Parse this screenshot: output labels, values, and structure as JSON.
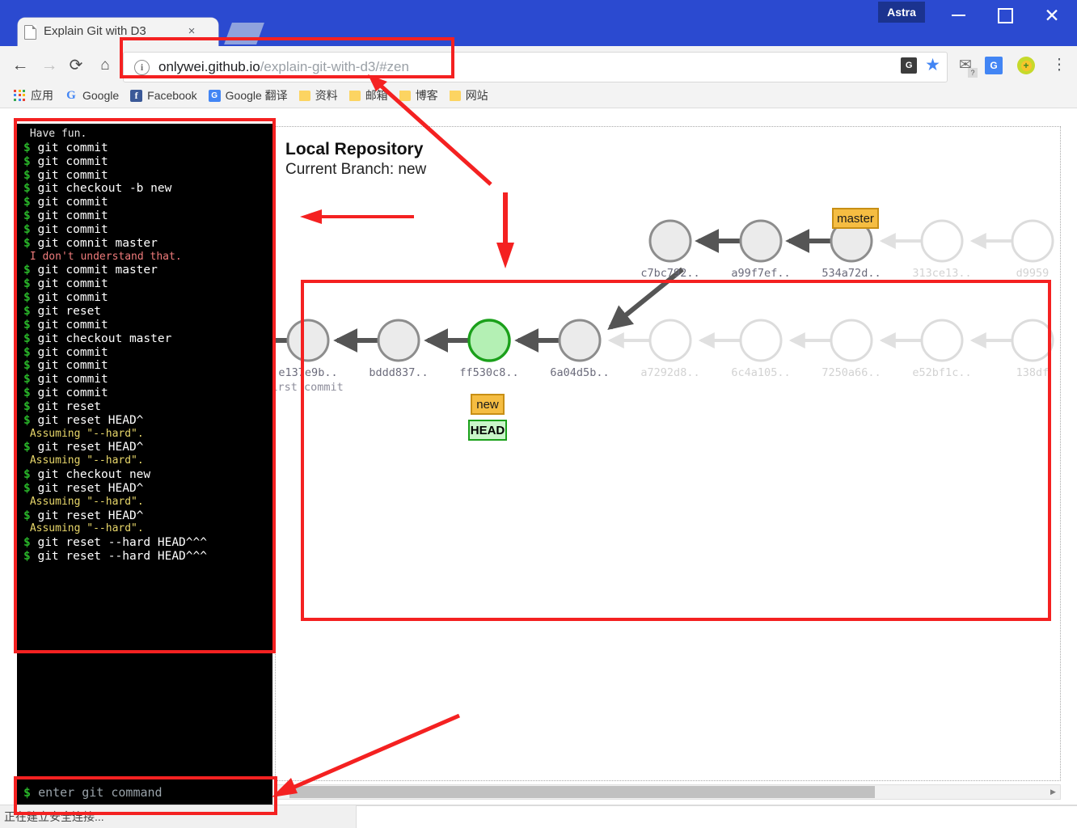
{
  "window": {
    "badge_label": "Astra",
    "minimize_icon": "minimize-icon",
    "maximize_icon": "maximize-icon",
    "close_icon": "close-icon"
  },
  "tab": {
    "title": "Explain Git with D3",
    "close_label": "×",
    "favicon": "page-icon"
  },
  "toolbar": {
    "back_glyph": "←",
    "forward_glyph": "→",
    "reload_glyph": "⟳",
    "home_glyph": "⌂",
    "url_host": "onlywei.github.io",
    "url_path": "/explain-git-with-d3/#zen",
    "url_full": "onlywei.github.io/explain-git-with-d3/#zen",
    "translate_badge": "G",
    "star_glyph": "★",
    "ext_mail_glyph": "M",
    "ext_mail_badge": "?",
    "ext_translate_badge": "G",
    "ext_green_badge": "+",
    "menu_glyph": "⋮"
  },
  "bookmarks": [
    {
      "label": "应用",
      "icon": "apps-grid-icon"
    },
    {
      "label": "Google",
      "icon": "google-icon"
    },
    {
      "label": "Facebook",
      "icon": "facebook-icon"
    },
    {
      "label": "Google 翻译",
      "icon": "google-translate-icon"
    },
    {
      "label": "资料",
      "icon": "folder-icon"
    },
    {
      "label": "邮箱",
      "icon": "folder-icon"
    },
    {
      "label": "博客",
      "icon": "folder-icon"
    },
    {
      "label": "网站",
      "icon": "folder-icon"
    }
  ],
  "terminal": {
    "lines": [
      {
        "type": "plain",
        "text": "Have fun."
      },
      {
        "type": "cmd",
        "text": "git commit"
      },
      {
        "type": "cmd",
        "text": "git commit"
      },
      {
        "type": "cmd",
        "text": "git commit"
      },
      {
        "type": "cmd",
        "text": "git checkout -b new"
      },
      {
        "type": "cmd",
        "text": "git commit"
      },
      {
        "type": "cmd",
        "text": "git commit"
      },
      {
        "type": "cmd",
        "text": "git commit"
      },
      {
        "type": "cmd",
        "text": "git comnit master"
      },
      {
        "type": "err",
        "text": "I don't understand that."
      },
      {
        "type": "cmd",
        "text": "git commit master"
      },
      {
        "type": "cmd",
        "text": "git commit"
      },
      {
        "type": "cmd",
        "text": "git commit"
      },
      {
        "type": "cmd",
        "text": "git reset"
      },
      {
        "type": "cmd",
        "text": "git commit"
      },
      {
        "type": "cmd",
        "text": "git checkout master"
      },
      {
        "type": "cmd",
        "text": "git commit"
      },
      {
        "type": "cmd",
        "text": "git commit"
      },
      {
        "type": "cmd",
        "text": "git commit"
      },
      {
        "type": "cmd",
        "text": "git commit"
      },
      {
        "type": "cmd",
        "text": "git reset"
      },
      {
        "type": "cmd",
        "text": "git reset HEAD^"
      },
      {
        "type": "info",
        "text": "Assuming \"--hard\"."
      },
      {
        "type": "cmd",
        "text": "git reset HEAD^"
      },
      {
        "type": "info",
        "text": "Assuming \"--hard\"."
      },
      {
        "type": "cmd",
        "text": "git checkout new"
      },
      {
        "type": "cmd",
        "text": "git reset HEAD^"
      },
      {
        "type": "info",
        "text": "Assuming \"--hard\"."
      },
      {
        "type": "cmd",
        "text": "git reset HEAD^"
      },
      {
        "type": "info",
        "text": "Assuming \"--hard\"."
      },
      {
        "type": "cmd",
        "text": "git reset --hard HEAD^^^"
      },
      {
        "type": "cmd",
        "text": "git reset --hard HEAD^^^"
      }
    ],
    "prompt": "$",
    "input_placeholder": "enter git command",
    "input_value": ""
  },
  "repo": {
    "title": "Local Repository",
    "branch_line": "Current Branch: new"
  },
  "graph": {
    "upper_row": [
      {
        "id": "c7bc792..",
        "faded": false
      },
      {
        "id": "a99f7ef..",
        "faded": false
      },
      {
        "id": "534a72d..",
        "faded": false
      },
      {
        "id": "313ce13..",
        "faded": true
      },
      {
        "id": "d9959",
        "faded": true
      }
    ],
    "lower_row": [
      {
        "id": "e137e9b..",
        "faded": false,
        "message": "first commit"
      },
      {
        "id": "bddd837..",
        "faded": false
      },
      {
        "id": "ff530c8..",
        "faded": false,
        "head": true
      },
      {
        "id": "6a04d5b..",
        "faded": false
      },
      {
        "id": "a7292d8..",
        "faded": true
      },
      {
        "id": "6c4a105..",
        "faded": true
      },
      {
        "id": "7250a66..",
        "faded": true
      },
      {
        "id": "e52bf1c..",
        "faded": true
      },
      {
        "id": "138df",
        "faded": true
      }
    ],
    "tags": {
      "master": "master",
      "new": "new",
      "head": "HEAD"
    },
    "colors": {
      "head_node_fill": "#b4f0b4",
      "head_node_stroke": "#1ba01b",
      "branch_tag_fill": "#f5bd42",
      "branch_tag_stroke": "#c88f15",
      "node_fill": "#ebebeb",
      "node_stroke": "#8d8d8d",
      "annotation_red": "#f42121"
    }
  },
  "scrollbar": {
    "left_arrow": "◀",
    "right_arrow": "▶"
  },
  "status": {
    "text": "正在建立安全连接..."
  }
}
